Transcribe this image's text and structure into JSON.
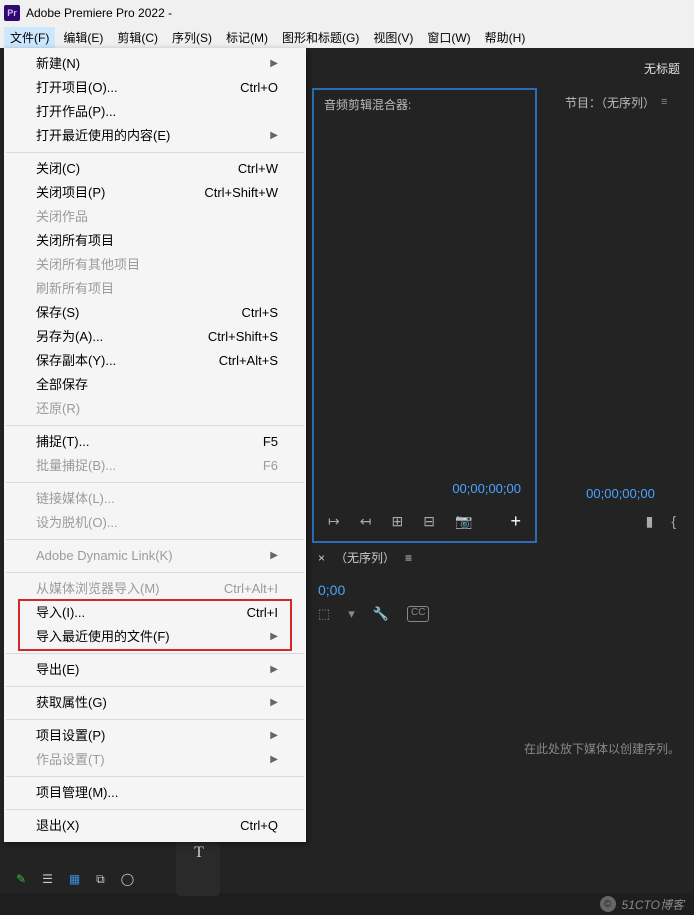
{
  "titlebar": {
    "app_name": "Adobe Premiere Pro 2022 -"
  },
  "menubar": [
    "文件(F)",
    "编辑(E)",
    "剪辑(C)",
    "序列(S)",
    "标记(M)",
    "图形和标题(G)",
    "视图(V)",
    "窗口(W)",
    "帮助(H)"
  ],
  "file_menu": [
    {
      "label": "新建(N)",
      "submenu": true
    },
    {
      "label": "打开项目(O)...",
      "shortcut": "Ctrl+O"
    },
    {
      "label": "打开作品(P)..."
    },
    {
      "label": "打开最近使用的内容(E)",
      "submenu": true
    },
    {
      "sep": true
    },
    {
      "label": "关闭(C)",
      "shortcut": "Ctrl+W"
    },
    {
      "label": "关闭项目(P)",
      "shortcut": "Ctrl+Shift+W"
    },
    {
      "label": "关闭作品",
      "disabled": true
    },
    {
      "label": "关闭所有项目"
    },
    {
      "label": "关闭所有其他项目",
      "disabled": true
    },
    {
      "label": "刷新所有项目",
      "disabled": true
    },
    {
      "label": "保存(S)",
      "shortcut": "Ctrl+S"
    },
    {
      "label": "另存为(A)...",
      "shortcut": "Ctrl+Shift+S"
    },
    {
      "label": "保存副本(Y)...",
      "shortcut": "Ctrl+Alt+S"
    },
    {
      "label": "全部保存"
    },
    {
      "label": "还原(R)",
      "disabled": true
    },
    {
      "sep": true
    },
    {
      "label": "捕捉(T)...",
      "shortcut": "F5"
    },
    {
      "label": "批量捕捉(B)...",
      "shortcut": "F6",
      "disabled": true
    },
    {
      "sep": true
    },
    {
      "label": "链接媒体(L)...",
      "disabled": true
    },
    {
      "label": "设为脱机(O)...",
      "disabled": true
    },
    {
      "sep": true
    },
    {
      "label": "Adobe Dynamic Link(K)",
      "submenu": true,
      "disabled": true
    },
    {
      "sep": true
    },
    {
      "label": "从媒体浏览器导入(M)",
      "shortcut": "Ctrl+Alt+I",
      "disabled": true
    },
    {
      "label": "导入(I)...",
      "shortcut": "Ctrl+I",
      "hl": true
    },
    {
      "label": "导入最近使用的文件(F)",
      "submenu": true,
      "hl": true
    },
    {
      "sep": true
    },
    {
      "label": "导出(E)",
      "submenu": true
    },
    {
      "sep": true
    },
    {
      "label": "获取属性(G)",
      "submenu": true
    },
    {
      "sep": true
    },
    {
      "label": "项目设置(P)",
      "submenu": true
    },
    {
      "label": "作品设置(T)",
      "submenu": true,
      "disabled": true
    },
    {
      "sep": true
    },
    {
      "label": "项目管理(M)..."
    },
    {
      "sep": true
    },
    {
      "label": "退出(X)",
      "shortcut": "Ctrl+Q"
    }
  ],
  "tabrow": {
    "untitled": "无标题"
  },
  "audio_panel": {
    "title": "音频剪辑混合器:",
    "timecode": "00;00;00;00"
  },
  "program_panel": {
    "title": "节目：（无序列）",
    "timecode": "00;00;00;00"
  },
  "timeline": {
    "title": "（无序列）",
    "timecode": "0;00",
    "drop_hint": "在此处放下媒体以创建序列。"
  },
  "tools": {
    "text": "T"
  },
  "watermark": "51CTO博客"
}
